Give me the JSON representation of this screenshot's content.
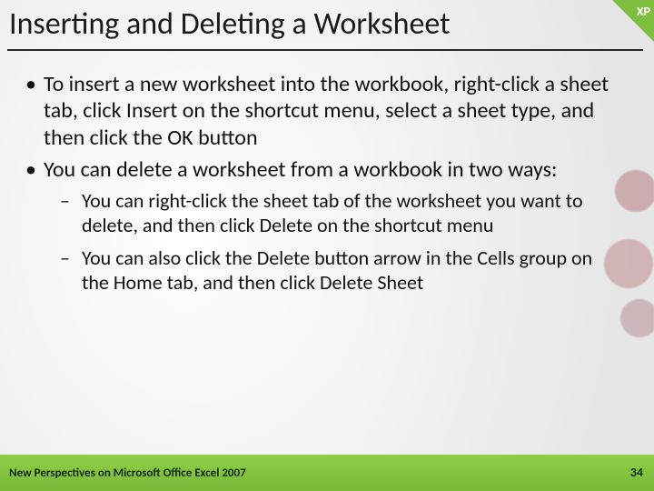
{
  "corner_label": "XP",
  "title": "Inserting and Deleting a Worksheet",
  "bullets": [
    {
      "text": "To insert a new worksheet into the workbook, right-click a sheet tab, click Insert on the shortcut menu, select a sheet type, and then click the OK button",
      "sub": []
    },
    {
      "text": "You can delete a worksheet from a workbook in two ways:",
      "sub": [
        "You can right-click the sheet tab of the worksheet you want to delete, and then click Delete on the shortcut menu",
        "You can also click the Delete button arrow in the Cells group on the Home tab, and then click Delete Sheet"
      ]
    }
  ],
  "footer": "New Perspectives on Microsoft Office Excel 2007",
  "page_number": "34"
}
